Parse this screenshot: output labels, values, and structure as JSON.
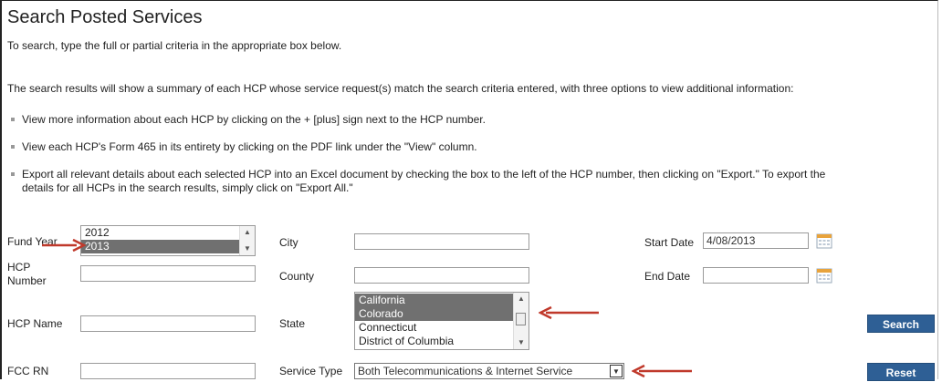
{
  "page": {
    "title": "Search Posted Services",
    "intro": "To search, type the full or partial criteria in the appropriate box below.",
    "results_intro": "The search results will show a summary of each HCP whose service request(s) match the search criteria entered, with three options to view additional information:",
    "bullets": [
      "View more information about each HCP by clicking on the + [plus] sign next to the HCP number.",
      "View each HCP's Form 465 in its entirety by clicking on the PDF link under the \"View\" column.",
      "Export all relevant details about each selected HCP into an Excel document by checking the box to the left of the HCP number, then clicking on \"Export.\" To export the",
      "details for all HCPs in the search results, simply click on \"Export All.\""
    ]
  },
  "form": {
    "fund_year": {
      "label": "Fund Year",
      "options": [
        {
          "text": "2012",
          "selected": false
        },
        {
          "text": "2013",
          "selected": true
        }
      ]
    },
    "hcp_number": {
      "label_line1": "HCP",
      "label_line2": "Number",
      "value": ""
    },
    "hcp_name": {
      "label": "HCP Name",
      "value": ""
    },
    "fcc_rn": {
      "label": "FCC RN",
      "value": ""
    },
    "city": {
      "label": "City",
      "value": ""
    },
    "county": {
      "label": "County",
      "value": ""
    },
    "state": {
      "label": "State",
      "options": [
        {
          "text": "California",
          "selected": true
        },
        {
          "text": "Colorado",
          "selected": true
        },
        {
          "text": "Connecticut",
          "selected": false
        },
        {
          "text": "District of Columbia",
          "selected": false
        }
      ]
    },
    "service_type": {
      "label": "Service Type",
      "value": "Both Telecommunications & Internet Service"
    },
    "start_date": {
      "label": "Start Date",
      "value": "4/08/2013"
    },
    "end_date": {
      "label": "End Date",
      "value": ""
    },
    "search_button": "Search",
    "reset_button": "Reset"
  },
  "colors": {
    "button": "#2e5f95",
    "arrow": "#c0392b",
    "selected_option": "#707070"
  },
  "icons": [
    "calendar-icon",
    "scroll-up-arrow-icon",
    "scroll-down-arrow-icon",
    "dropdown-arrow-icon",
    "annotation-arrow-icon"
  ]
}
